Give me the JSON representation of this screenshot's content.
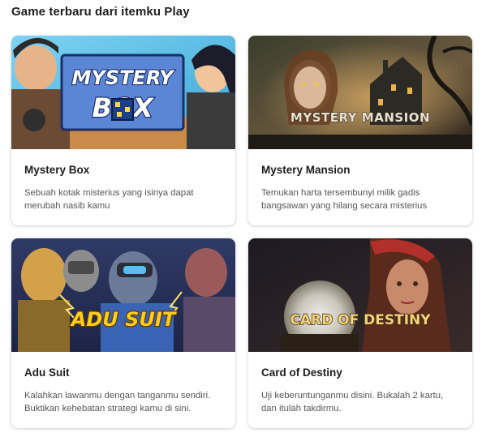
{
  "section": {
    "heading": "Game terbaru dari itemku Play"
  },
  "games": [
    {
      "title": "Mystery Box",
      "description": "Sebuah kotak misterius yang isinya dapat merubah nasib kamu",
      "logo_line1": "MYSTERY",
      "logo_line2": "BOX"
    },
    {
      "title": "Mystery Mansion",
      "description": "Temukan harta tersembunyi milik gadis bangsawan yang hilang secara misterius",
      "logo": "MYSTERY MANSION"
    },
    {
      "title": "Adu Suit",
      "description": "Kalahkan lawanmu dengan tanganmu sendiri. Buktikan kehebatan strategi kamu di sini.",
      "logo": "ADU SUIT"
    },
    {
      "title": "Card of Destiny",
      "description": "Uji keberuntunganmu disini. Bukalah 2 kartu, dan itulah takdirmu.",
      "logo": "CARD OF DESTINY"
    }
  ],
  "colors": {
    "card_bg": "#ffffff",
    "title": "#1d1d1d",
    "description": "#555555"
  }
}
